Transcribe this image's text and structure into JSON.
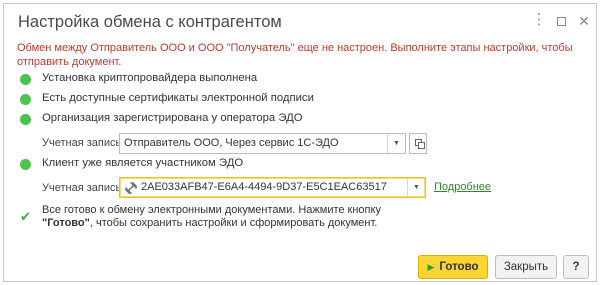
{
  "window": {
    "title": "Настройка обмена с контрагентом",
    "menu_icon": "more-vertical-icon",
    "maximize_icon": "maximize-icon",
    "close_icon": "close-icon"
  },
  "warning_text": "Обмен между Отправитель ООО и ООО \"Получатель\" еще не настроен. Выполните этапы настройки, чтобы отправить документ.",
  "steps": [
    {
      "text": "Установка криптопровайдера выполнена",
      "status_color": "#4dc24d"
    },
    {
      "text": "Есть доступные сертификаты электронной подписи",
      "status_color": "#4dc24d"
    },
    {
      "text": "Организация зарегистрирована у оператора ЭДО",
      "status_color": "#4dc24d"
    },
    {
      "text": "Клиент уже является участником ЭДО",
      "status_color": "#4dc24d"
    }
  ],
  "account_field_1": {
    "label": "Учетная запись:",
    "value": "Отправитель ООО, Через сервис 1С-ЭДО"
  },
  "account_field_2": {
    "label": "Учетная запись:",
    "value": "2AE033AFB47-E6A4-4494-9D37-E5C1EAC63517"
  },
  "details_link": "Подробнее",
  "ready_message": {
    "part1": "Все готово к обмену электронными документами. Нажмите кнопку",
    "bold": "\"Готово\"",
    "part2": ", чтобы сохранить настройки и сформировать документ."
  },
  "buttons": {
    "ok": "Готово",
    "close": "Закрыть",
    "help": "?"
  },
  "colors": {
    "accent_yellow": "#fbd632",
    "success_green": "#4dc24d",
    "warning_red": "#c0392b",
    "link_green": "#2a8a2a"
  }
}
